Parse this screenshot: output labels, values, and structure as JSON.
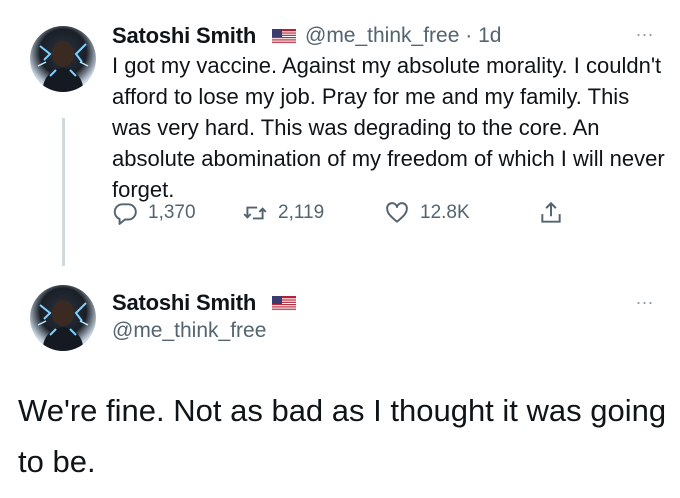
{
  "tweet1": {
    "name": "Satoshi Smith",
    "handle": "@me_think_free",
    "separator": "·",
    "time": "1d",
    "text": "I got my vaccine. Against my absolute morality. I couldn't afford to lose my job. Pray for me and my family. This was very hard. This was degrading to the core. An absolute abomination of my freedom of which I will never forget.",
    "replies": "1,370",
    "retweets": "2,119",
    "likes": "12.8K",
    "more": "..."
  },
  "tweet2": {
    "name": "Satoshi Smith",
    "handle": "@me_think_free",
    "text": "We're fine. Not as bad as I thought it was going to be.",
    "more": "..."
  },
  "icons": {
    "flag": "us-flag-icon",
    "reply": "reply-icon",
    "retweet": "retweet-icon",
    "like": "heart-icon",
    "share": "share-icon",
    "more": "more-icon"
  },
  "colors": {
    "text": "#0f1419",
    "secondary": "#536471",
    "thread_line": "#cfd9de"
  }
}
